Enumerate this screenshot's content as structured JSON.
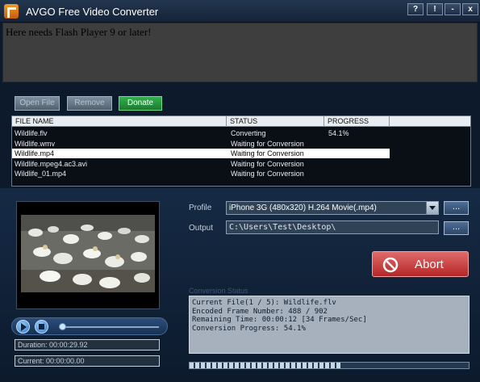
{
  "window": {
    "title": "AVGO Free Video Converter",
    "help_label": "?",
    "alert_label": "!",
    "min_label": "-",
    "close_label": "x"
  },
  "flash": {
    "message": "Here needs Flash Player 9 or later!"
  },
  "toolbar": {
    "open_label": "Open File",
    "remove_label": "Remove",
    "donate_label": "Donate"
  },
  "table": {
    "headers": [
      "FILE NAME",
      "STATUS",
      "PROGRESS"
    ],
    "rows": [
      {
        "name": "Wildlife.flv",
        "status": "Converting",
        "progress": "54.1%"
      },
      {
        "name": "Wildlife.wmv",
        "status": "Waiting for Conversion",
        "progress": ""
      },
      {
        "name": "Wildlife.mp4",
        "status": "Waiting for Conversion",
        "progress": "",
        "selected": true
      },
      {
        "name": "Wildlife.mpeg4.ac3.avi",
        "status": "Waiting for Conversion",
        "progress": ""
      },
      {
        "name": "Wildlife_01.mp4",
        "status": "Waiting for Conversion",
        "progress": ""
      }
    ]
  },
  "player": {
    "duration_text": "Duration: 00:00:29.92",
    "current_text": "Current: 00:00:00.00"
  },
  "settings": {
    "profile_label": "Profile",
    "profile_value": "iPhone 3G (480x320) H.264 Movie(.mp4)",
    "output_label": "Output",
    "output_value": "C:\\Users\\Test\\Desktop\\",
    "browse_label": "..."
  },
  "abort": {
    "label": "Abort"
  },
  "conversion": {
    "title": "Conversion Status",
    "lines": [
      "Current File(1 / 5): Wildlife.flv",
      "Encoded Frame Number: 488 / 902",
      "Remaining Time: 00:00:12 [34 Frames/Sec]",
      "Conversion Progress: 54.1%"
    ],
    "progress_fraction": 0.541
  },
  "colors": {
    "accent": "#1c7a31",
    "abort": "#b52727",
    "selected_row": "#ffffff"
  }
}
